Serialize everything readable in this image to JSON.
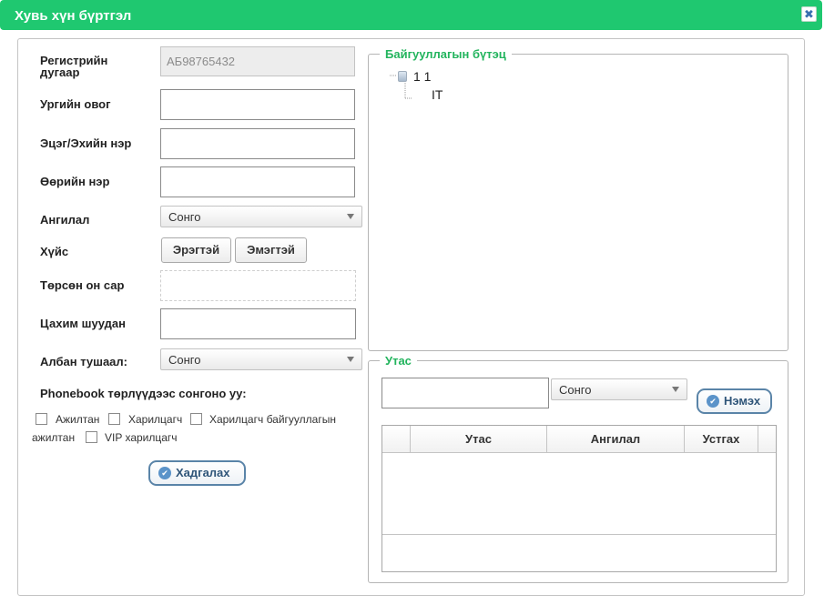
{
  "window": {
    "title": "Хувь хүн бүртгэл",
    "close_glyph": "✖"
  },
  "form": {
    "register_label": "Регистрийн дугаар",
    "register_value": "АБ98765432",
    "family_label": "Ургийн овог",
    "father_label": "Эцэг/Эхийн нэр",
    "own_label": "Өөрийн нэр",
    "category_label": "Ангилал",
    "category_value": "Сонго",
    "gender_label": "Хүйс",
    "gender_male": "Эрэгтэй",
    "gender_female": "Эмэгтэй",
    "birth_label": "Төрсөн он сар",
    "email_label": "Цахим шуудан",
    "position_label": "Албан тушаал:",
    "position_value": "Сонго",
    "phonebook_label": "Phonebook төрлүүдээс сонгоно уу:",
    "types": [
      "Ажилтан",
      "Харилцагч",
      "Харилцагч байгууллагын",
      "ажилтан",
      "VIP харилцагч"
    ],
    "save_label": "Хадгалах"
  },
  "org": {
    "legend": "Байгууллагын бүтэц",
    "nodes": [
      "1 1",
      "IT"
    ]
  },
  "phone": {
    "legend": "Утас",
    "type_value": "Сонго",
    "add_label": "Нэмэх",
    "columns": [
      "Утас",
      "Ангилал",
      "Устгах"
    ]
  },
  "icons": {
    "close": "close-icon",
    "ok": "check-circle-icon",
    "tree_node": "tree-node-icon",
    "caret": "chevron-down-icon"
  }
}
